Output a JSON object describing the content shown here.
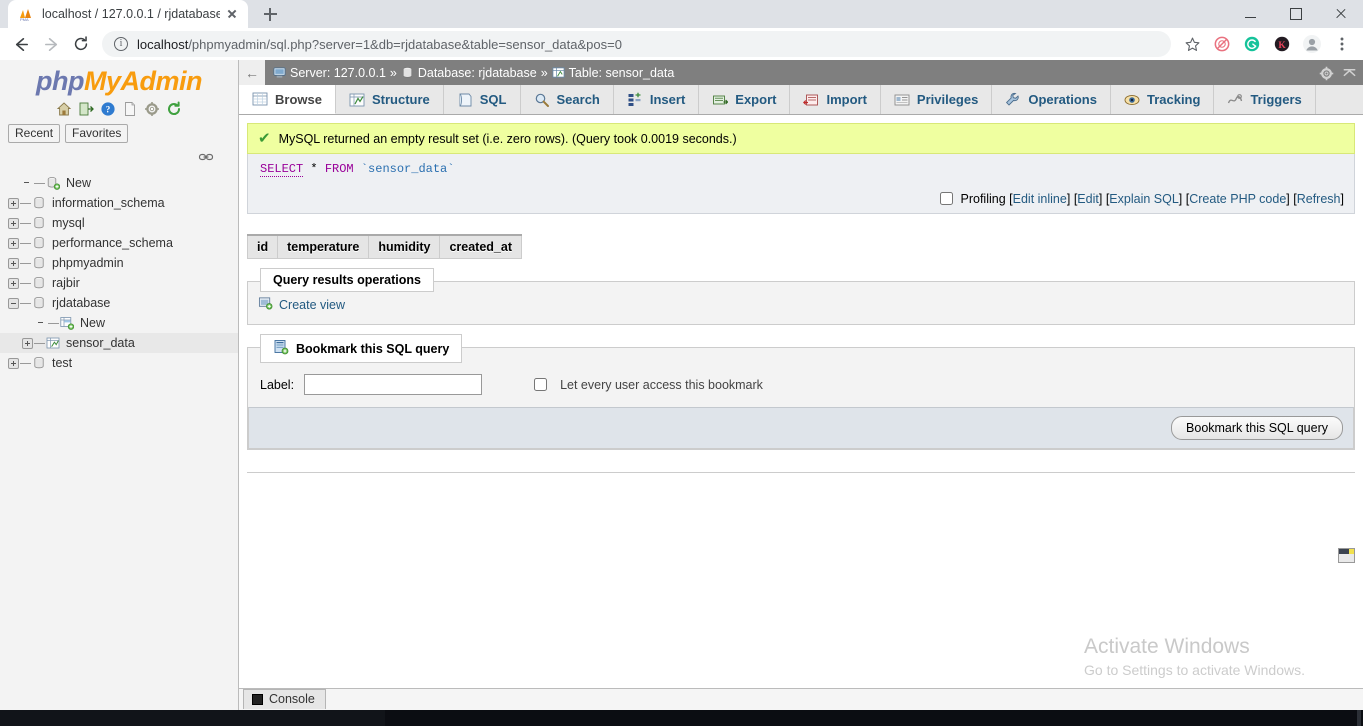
{
  "browser": {
    "tab": {
      "title": "localhost / 127.0.0.1 / rjdatabase",
      "favicon_icon": "phpmyadmin-favicon"
    },
    "newtab_icon": "plus-icon",
    "window": {
      "minimize_icon": "minimize-icon",
      "maximize_icon": "maximize-icon",
      "close_icon": "close-icon"
    },
    "nav": {
      "back_icon": "back-arrow-icon",
      "forward_icon": "forward-arrow-icon",
      "reload_icon": "reload-icon"
    },
    "omnibox": {
      "info_icon": "info-circle-icon",
      "url_host": "localhost",
      "url_path": "/phpmyadmin/sql.php?server=1&db=rjdatabase&table=sensor_data&pos=0"
    },
    "toolbar_icons": [
      "star-icon",
      "adblock-icon",
      "grammarly-icon",
      "kaspersky-icon",
      "profile-avatar-icon",
      "chrome-menu-icon"
    ]
  },
  "sidebar": {
    "logo": {
      "part1": "php",
      "part2": "My",
      "part3": "Admin"
    },
    "quick_icons": [
      "home-icon",
      "logout-icon",
      "docs-icon",
      "wiki-icon",
      "settings-icon",
      "reload-icon"
    ],
    "chips": [
      {
        "label": "Recent"
      },
      {
        "label": "Favorites"
      }
    ],
    "link_icon": "chain-link-icon",
    "tree": [
      {
        "label": "New",
        "indent": 1,
        "toggle": "none",
        "icon": "new-db-icon",
        "selected": false
      },
      {
        "label": "information_schema",
        "indent": 0,
        "toggle": "plus",
        "icon": "db-icon",
        "selected": false
      },
      {
        "label": "mysql",
        "indent": 0,
        "toggle": "plus",
        "icon": "db-icon",
        "selected": false
      },
      {
        "label": "performance_schema",
        "indent": 0,
        "toggle": "plus",
        "icon": "db-icon",
        "selected": false
      },
      {
        "label": "phpmyadmin",
        "indent": 0,
        "toggle": "plus",
        "icon": "db-icon",
        "selected": false
      },
      {
        "label": "rajbir",
        "indent": 0,
        "toggle": "plus",
        "icon": "db-icon",
        "selected": false
      },
      {
        "label": "rjdatabase",
        "indent": 0,
        "toggle": "minus",
        "icon": "db-icon",
        "selected": false
      },
      {
        "label": "New",
        "indent": 2,
        "toggle": "none",
        "icon": "new-table-icon",
        "selected": false
      },
      {
        "label": "sensor_data",
        "indent": 1,
        "toggle": "plus",
        "icon": "table-icon",
        "selected": true
      },
      {
        "label": "test",
        "indent": 0,
        "toggle": "plus",
        "icon": "db-icon",
        "selected": false
      }
    ]
  },
  "breadcrumb": {
    "back_icon": "back-arrow-icon",
    "server_icon": "server-icon",
    "server": "Server: 127.0.0.1",
    "sep1": "»",
    "database_icon": "database-icon",
    "database": "Database: rjdatabase",
    "sep2": "»",
    "table_icon": "table-icon",
    "table": "Table: sensor_data",
    "settings_icon": "gear-icon",
    "collapse_icon": "collapse-up-icon"
  },
  "tabs": [
    {
      "label": "Browse",
      "icon": "browse-icon",
      "active": true
    },
    {
      "label": "Structure",
      "icon": "structure-icon",
      "active": false
    },
    {
      "label": "SQL",
      "icon": "sql-icon",
      "active": false
    },
    {
      "label": "Search",
      "icon": "search-icon",
      "active": false
    },
    {
      "label": "Insert",
      "icon": "insert-icon",
      "active": false
    },
    {
      "label": "Export",
      "icon": "export-icon",
      "active": false
    },
    {
      "label": "Import",
      "icon": "import-icon",
      "active": false
    },
    {
      "label": "Privileges",
      "icon": "privileges-icon",
      "active": false
    },
    {
      "label": "Operations",
      "icon": "operations-icon",
      "active": false
    },
    {
      "label": "Tracking",
      "icon": "tracking-icon",
      "active": false
    },
    {
      "label": "Triggers",
      "icon": "triggers-icon",
      "active": false
    }
  ],
  "result": {
    "success_icon": "green-check-icon",
    "message": "MySQL returned an empty result set (i.e. zero rows). (Query took 0.0019 seconds.)",
    "sql": {
      "keyword_select": "SELECT",
      "star": "*",
      "keyword_from": "FROM",
      "table_ref": "`sensor_data`"
    },
    "actions": {
      "profiling_label": "Profiling",
      "profiling_checked": false,
      "links": [
        {
          "open": "[",
          "label": "Edit inline",
          "close": "]"
        },
        {
          "open": "[",
          "label": "Edit",
          "close": "]"
        },
        {
          "open": "[",
          "label": "Explain SQL",
          "close": "]"
        },
        {
          "open": "[",
          "label": "Create PHP code",
          "close": "]"
        },
        {
          "open": "[",
          "label": "Refresh",
          "close": "]"
        }
      ]
    },
    "columns": [
      "id",
      "temperature",
      "humidity",
      "created_at"
    ],
    "rows": []
  },
  "query_results_operations": {
    "legend": "Query results operations",
    "create_view_icon": "create-view-icon",
    "create_view_label": "Create view"
  },
  "bookmark": {
    "legend": "Bookmark this SQL query",
    "legend_icon": "bookmark-icon",
    "label_text": "Label:",
    "label_value": "",
    "label_placeholder": "",
    "checkbox_label": "Let every user access this bookmark",
    "checkbox_checked": false,
    "submit_label": "Bookmark this SQL query"
  },
  "floating_button_icon": "scroll-to-top-icon",
  "watermark": {
    "line1": "Activate Windows",
    "line2": "Go to Settings to activate Windows."
  },
  "console": {
    "icon": "console-icon",
    "label": "Console"
  },
  "taskbar": {
    "clock_time": "",
    "clock_date": ""
  }
}
